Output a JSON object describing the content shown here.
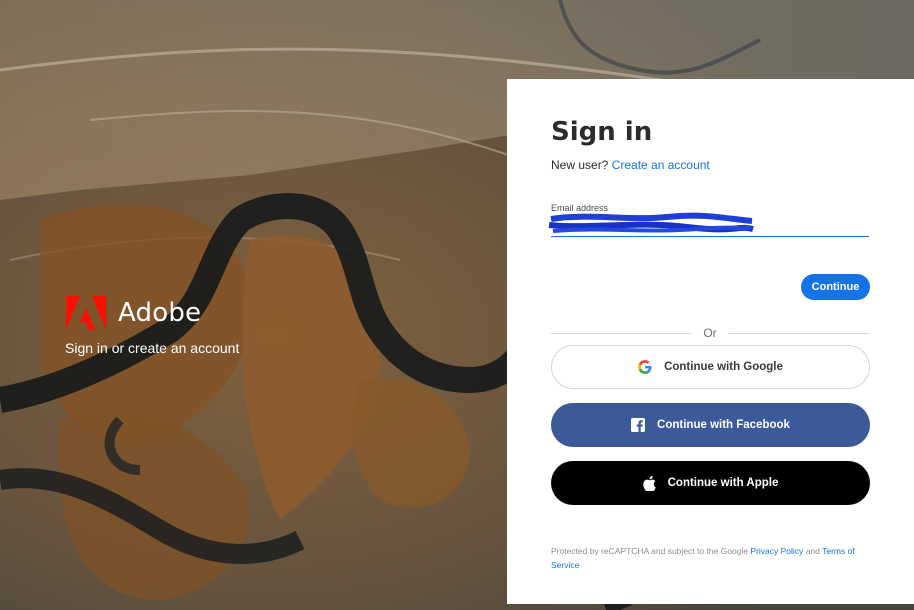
{
  "brand": {
    "name": "Adobe",
    "tagline": "Sign in or create an account"
  },
  "signin": {
    "title": "Sign in",
    "new_user_prefix": "New user?",
    "create_account_link": "Create an account",
    "email_label": "Email address",
    "email_value": "",
    "continue_label": "Continue",
    "divider_text": "Or",
    "google_label": "Continue with Google",
    "facebook_label": "Continue with Facebook",
    "apple_label": "Continue with Apple",
    "legal": {
      "prefix": "Protected by reCAPTCHA and subject to the Google",
      "privacy_link": "Privacy Policy",
      "and": "and",
      "terms_link": "Terms of Service"
    }
  },
  "colors": {
    "accent": "#1473e6",
    "facebook": "#3c5a99",
    "apple": "#000000",
    "adobe_red": "#fa0f00"
  },
  "icons": {
    "google": "google-g-icon",
    "facebook": "facebook-f-icon",
    "apple": "apple-icon",
    "logo": "adobe-logo-icon"
  }
}
